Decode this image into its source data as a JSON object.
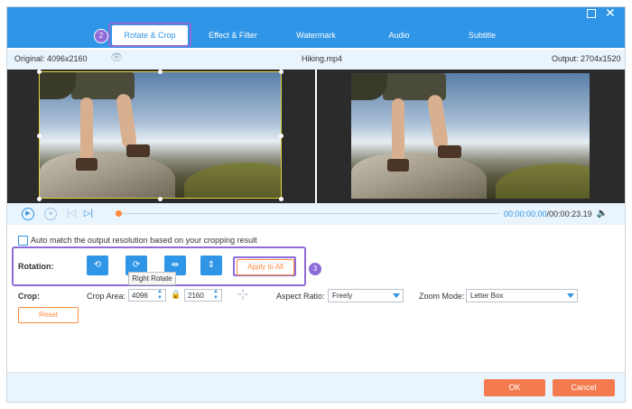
{
  "tabs": [
    {
      "label": "Rotate & Crop"
    },
    {
      "label": "Effect & Filter"
    },
    {
      "label": "Watermark"
    },
    {
      "label": "Audio"
    },
    {
      "label": "Subtitle"
    }
  ],
  "badges": {
    "step2": "2",
    "step3": "3"
  },
  "info": {
    "original": "Original: 4096x2160",
    "filename": "Hiking.mp4",
    "output": "Output: 2704x1520"
  },
  "playback": {
    "current_time": "00:00:00.00",
    "total_time": "/00:00:23.19"
  },
  "settings": {
    "auto_match_label": "Auto match the output resolution based on your cropping result",
    "rotation_label": "Rotation:",
    "apply_to_all": "Apply to All",
    "tooltip": "Right Rotate",
    "crop_label": "Crop:",
    "crop_area_label": "Crop Area:",
    "crop_width": "4096",
    "crop_height": "2160",
    "aspect_ratio_label": "Aspect Ratio:",
    "aspect_ratio_value": "Freely",
    "zoom_mode_label": "Zoom Mode:",
    "zoom_mode_value": "Letter Box",
    "reset_label": "Reset"
  },
  "footer": {
    "ok": "OK",
    "cancel": "Cancel"
  },
  "colors": {
    "accent": "#2f95e6",
    "orange": "#f47b4f",
    "highlight": "#8e6bd6"
  }
}
